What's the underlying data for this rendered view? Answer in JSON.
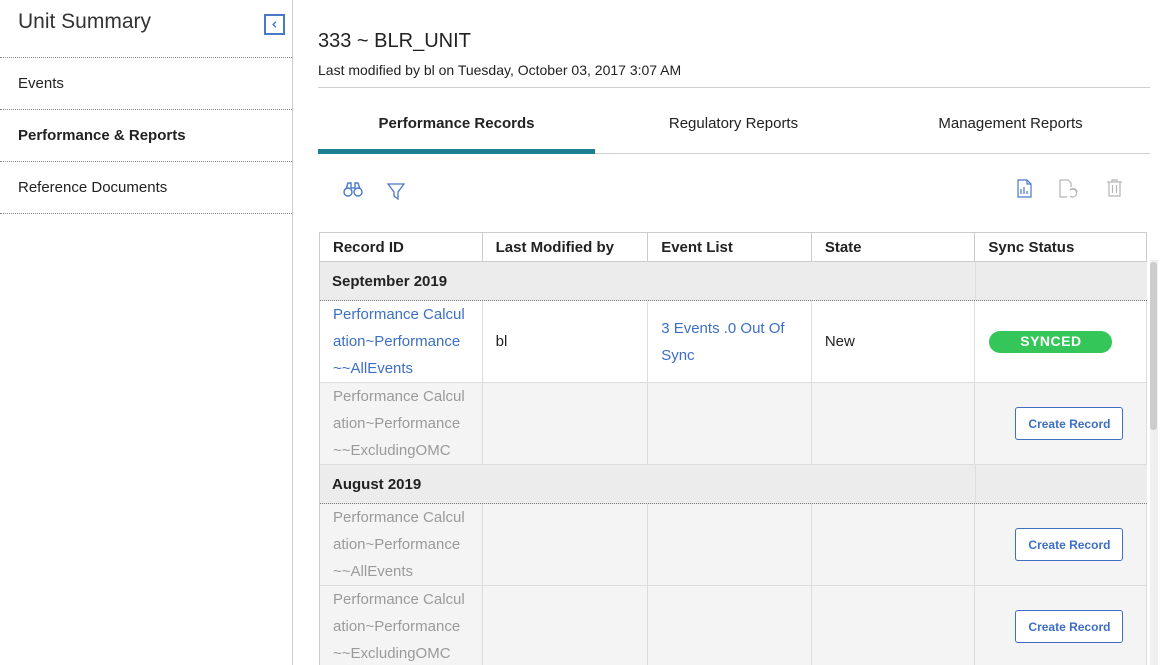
{
  "sidebar": {
    "title": "Unit Summary",
    "items": [
      {
        "label": "Events"
      },
      {
        "label": "Performance & Reports"
      },
      {
        "label": "Reference Documents"
      }
    ]
  },
  "header": {
    "title": "333 ~ BLR_UNIT",
    "modified": "Last modified by bl on Tuesday, October 03, 2017 3:07 AM"
  },
  "tabs": [
    {
      "label": "Performance Records"
    },
    {
      "label": "Regulatory Reports"
    },
    {
      "label": "Management Reports"
    }
  ],
  "toolbar": {
    "icons": [
      "binoculars-icon",
      "filter-icon",
      "report-icon",
      "sync-record-icon",
      "trash-icon"
    ]
  },
  "table": {
    "columns": [
      "Record ID",
      "Last Modified by",
      "Event List",
      "State",
      "Sync Status"
    ],
    "groups": [
      {
        "label": "September 2019",
        "rows": [
          {
            "id_lines": [
              "Performance Calcul",
              "ation~Performance",
              "~~AllEvents"
            ],
            "modified_by": "bl",
            "event_lines": [
              "3 Events .0 Out Of",
              "Sync"
            ],
            "state": "New",
            "sync": "SYNCED"
          },
          {
            "id_lines": [
              "Performance Calcul",
              "ation~Performance",
              "~~ExcludingOMC"
            ],
            "action": "Create Record"
          }
        ]
      },
      {
        "label": "August 2019",
        "rows": [
          {
            "id_lines": [
              "Performance Calcul",
              "ation~Performance",
              "~~AllEvents"
            ],
            "action": "Create Record"
          },
          {
            "id_lines": [
              "Performance Calcul",
              "ation~Performance",
              "~~ExcludingOMC"
            ],
            "action": "Create Record"
          }
        ]
      }
    ]
  },
  "colors": {
    "accent": "#1d7f92",
    "link": "#3d6fc5",
    "synced": "#34c659"
  }
}
